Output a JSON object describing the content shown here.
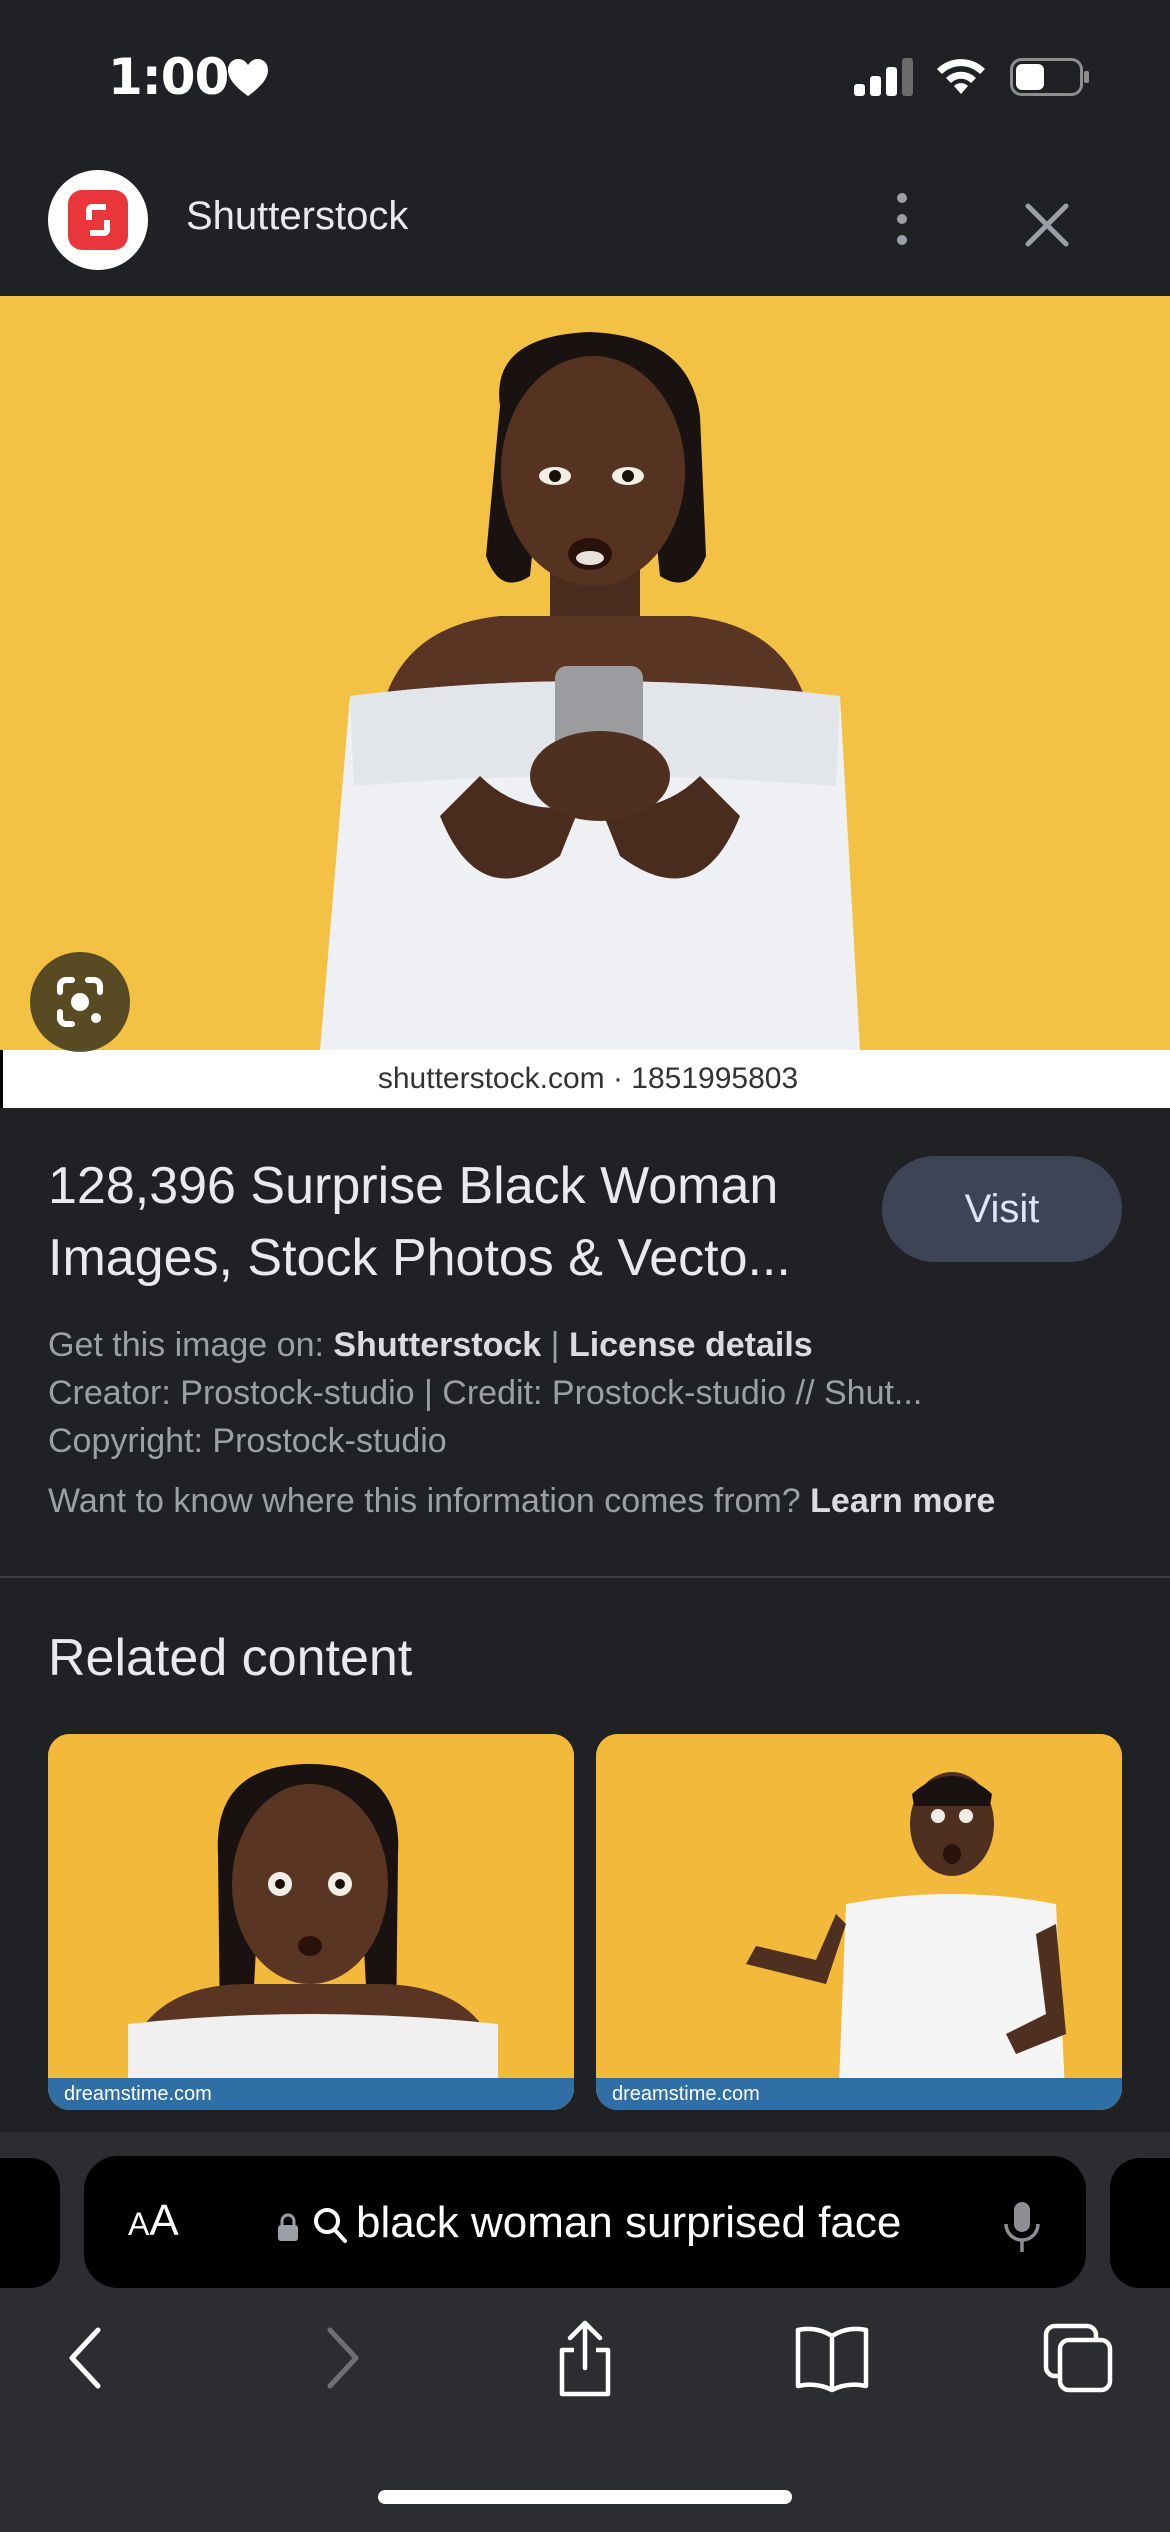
{
  "status_bar": {
    "time": "1:00",
    "icons": [
      "heart-icon",
      "cellular-signal-icon",
      "wifi-icon",
      "battery-icon"
    ]
  },
  "source": {
    "name": "Shutterstock",
    "logo_color": "#e8363b",
    "menu_icon": "more-vertical-icon",
    "close_icon": "close-icon"
  },
  "image": {
    "watermark": "shutterstock.com · 1851995803",
    "lens_icon": "google-lens-icon",
    "background_color": "#f3c144"
  },
  "details": {
    "title": "128,396 Surprise Black Woman Images, Stock Photos & Vecto...",
    "visit_label": "Visit",
    "get_image_prefix": "Get this image on: ",
    "get_image_source": "Shutterstock",
    "separator": " | ",
    "license_label": "License details",
    "creator_line": "Creator: Prostock-studio | Credit: Prostock-studio // Shut...",
    "copyright_line": "Copyright: Prostock-studio",
    "info_question": "Want to know where this information comes from? ",
    "learn_more": "Learn more"
  },
  "related": {
    "title": "Related content",
    "items": [
      {
        "watermark": "dreamstime.com"
      },
      {
        "watermark": "dreamstime.com"
      }
    ]
  },
  "browser": {
    "aa_small": "A",
    "aa_large": "A",
    "query": "black woman surprised face",
    "nav_icons": [
      "back-icon",
      "forward-icon",
      "share-icon",
      "bookmarks-icon",
      "tabs-icon"
    ]
  }
}
